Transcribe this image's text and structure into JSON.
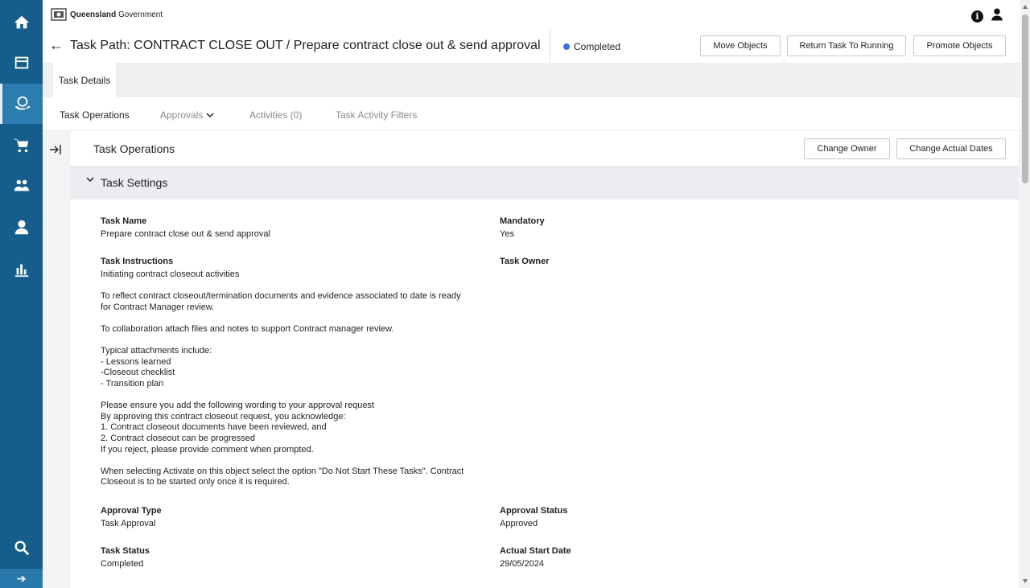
{
  "topbar": {
    "brand_bold": "Queensland",
    "brand_rest": " Government"
  },
  "header": {
    "back_glyph": "←",
    "title": "Task Path: CONTRACT CLOSE OUT / Prepare contract close out & send approval",
    "status": "Completed",
    "status_color": "#3a6fdc",
    "buttons": {
      "move": "Move Objects",
      "return": "Return Task To Running",
      "promote": "Promote Objects"
    }
  },
  "tabs": {
    "details": "Task Details",
    "sub": {
      "operations": "Task Operations",
      "approvals": "Approvals",
      "activities": "Activities (0)",
      "filters": "Task Activity Filters"
    }
  },
  "content": {
    "title": "Task Operations",
    "buttons": {
      "change_owner": "Change Owner",
      "change_dates": "Change Actual Dates"
    },
    "section": "Task Settings",
    "fields": {
      "task_name": {
        "label": "Task Name",
        "value": "Prepare contract close out & send approval"
      },
      "mandatory": {
        "label": "Mandatory",
        "value": "Yes"
      },
      "instructions": {
        "label": "Task Instructions",
        "value": "Initiating contract closeout activities\n\nTo reflect contract closeout/termination documents and evidence associated to date is ready\nfor Contract Manager review.\n\nTo collaboration attach files and notes to support Contract manager review.\n\nTypical attachments include:\n- Lessons learned\n-Closeout checklist\n- Transition plan\n\nPlease ensure you add the following wording to your approval request\nBy approving this contract closeout request, you acknowledge:\n1. Contract closeout documents have been reviewed, and\n2. Contract closeout can be progressed\nIf you reject, please provide comment when prompted.\n\nWhen selecting Activate on this object select the option \"Do Not Start These Tasks\". Contract\nCloseout is to be started only once it is required."
      },
      "task_owner": {
        "label": "Task Owner",
        "value": ""
      },
      "approval_type": {
        "label": "Approval Type",
        "value": "Task Approval"
      },
      "approval_status": {
        "label": "Approval Status",
        "value": "Approved"
      },
      "task_status": {
        "label": "Task Status",
        "value": "Completed"
      },
      "actual_start": {
        "label": "Actual Start Date",
        "value": "29/05/2024"
      }
    }
  },
  "nav": {
    "items": [
      "home-icon",
      "dashboard-icon",
      "globe-hands-icon",
      "cart-icon",
      "team-icon",
      "user-icon",
      "bar-chart-icon",
      "search-icon"
    ],
    "expand_glyph": "➔"
  },
  "colors": {
    "nav_bg": "#155d8a",
    "nav_active": "#2c7cb0",
    "section_bg": "#ecedf1"
  }
}
